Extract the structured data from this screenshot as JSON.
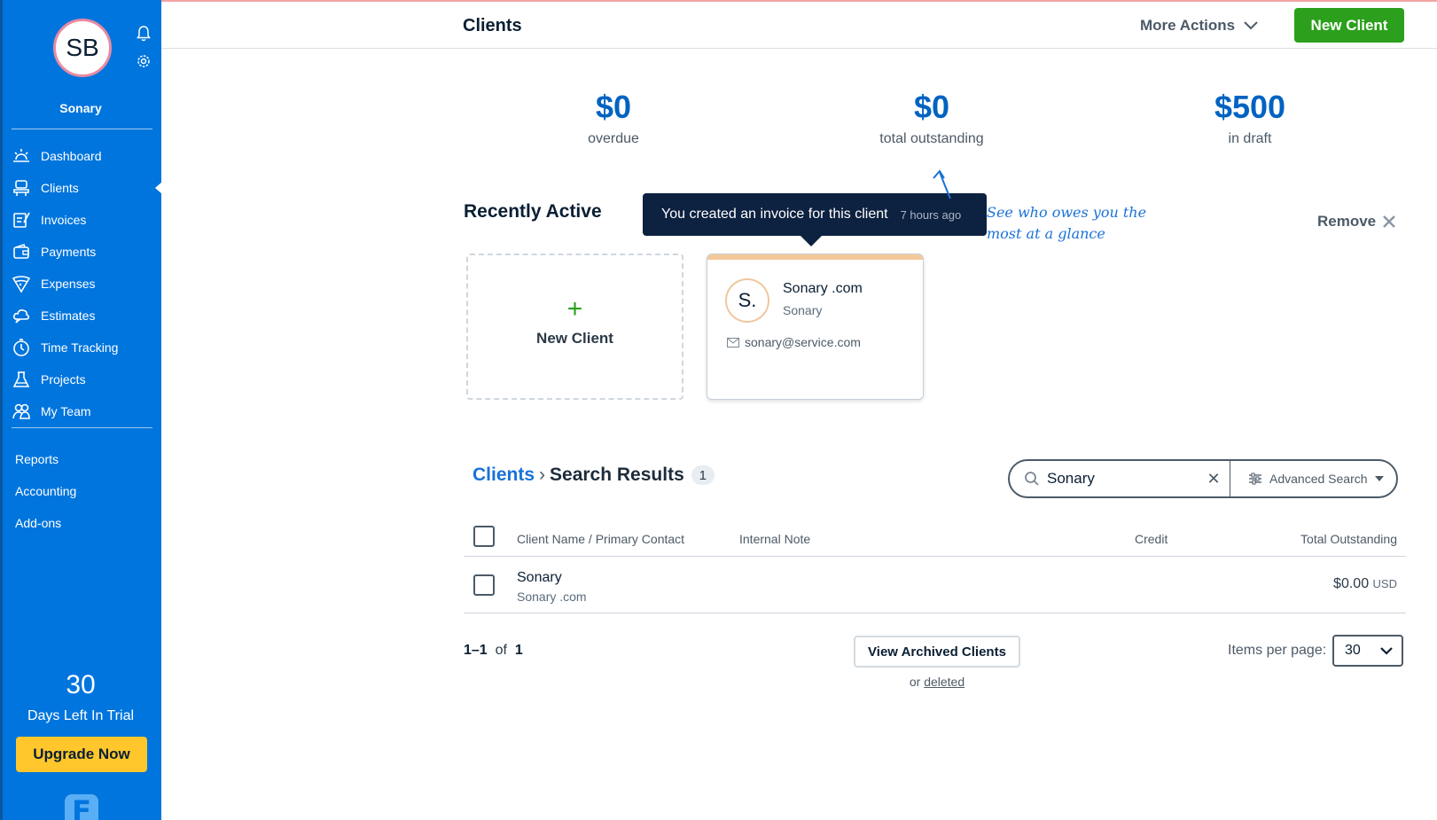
{
  "sidebar": {
    "avatar_initials": "SB",
    "company_name": "Sonary",
    "items": [
      {
        "label": "Dashboard",
        "icon": "dashboard-sun-icon"
      },
      {
        "label": "Clients",
        "icon": "clients-icon",
        "active": true
      },
      {
        "label": "Invoices",
        "icon": "invoices-icon"
      },
      {
        "label": "Payments",
        "icon": "payments-wallet-icon"
      },
      {
        "label": "Expenses",
        "icon": "expenses-pizza-icon"
      },
      {
        "label": "Estimates",
        "icon": "estimates-cloud-icon"
      },
      {
        "label": "Time Tracking",
        "icon": "clock-icon"
      },
      {
        "label": "Projects",
        "icon": "flask-icon"
      },
      {
        "label": "My Team",
        "icon": "team-icon"
      }
    ],
    "secondary": [
      "Reports",
      "Accounting",
      "Add-ons"
    ],
    "trial_days": "30",
    "trial_label": "Days Left In Trial",
    "upgrade_label": "Upgrade Now",
    "logo_letter": "F"
  },
  "header": {
    "title": "Clients",
    "more_actions": "More Actions",
    "new_client": "New Client"
  },
  "summary": {
    "overdue_value": "$0",
    "overdue_label": "overdue",
    "outstanding_value": "$0",
    "outstanding_label": "total outstanding",
    "draft_value": "$500",
    "draft_label": "in draft"
  },
  "recent": {
    "title": "Recently Active",
    "tooltip_text": "You created an invoice for this client",
    "tooltip_time": "7 hours ago",
    "hint": "See who owes you the most at a glance",
    "remove_label": "Remove",
    "new_client_card": "New Client",
    "card": {
      "initials": "S.",
      "name": "Sonary .com",
      "company": "Sonary",
      "email": "sonary@service.com"
    }
  },
  "results": {
    "crumb_link": "Clients",
    "crumb_current": "Search Results",
    "count": "1",
    "search_value": "Sonary",
    "advanced_search": "Advanced Search",
    "columns": {
      "name": "Client Name / Primary Contact",
      "note": "Internal Note",
      "credit": "Credit",
      "outstanding": "Total Outstanding"
    },
    "rows": [
      {
        "name": "Sonary",
        "sub": "Sonary .com",
        "amount": "$0.00",
        "currency": "USD"
      }
    ],
    "pager_range": "1–1",
    "pager_of": "of",
    "pager_total": "1",
    "view_archived": "View Archived Clients",
    "or_text": "or",
    "deleted_link": "deleted",
    "items_per_page_label": "Items per page:",
    "items_per_page_value": "30"
  },
  "colors": {
    "sidebar_bg": "#0075dd",
    "primary_green": "#2ca01c",
    "upgrade_yellow": "#ffc72c",
    "stat_blue": "#0063c1"
  }
}
